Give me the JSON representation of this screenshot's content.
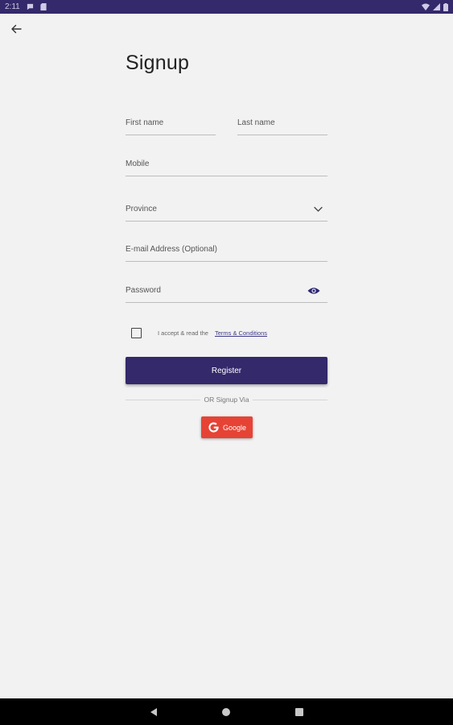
{
  "status_bar": {
    "time": "2:11",
    "left_icons": [
      "chat-icon",
      "sd-card-icon"
    ],
    "right_icons": [
      "wifi-icon",
      "signal-icon",
      "battery-icon"
    ],
    "background": "#33296b"
  },
  "header": {
    "back_icon": "arrow-left-icon",
    "title": "Signup"
  },
  "form": {
    "first_name_placeholder": "First name",
    "last_name_placeholder": "Last name",
    "mobile_placeholder": "Mobile",
    "province_placeholder": "Province",
    "email_placeholder": "E-mail Address (Optional)",
    "password_placeholder": "Password",
    "password_toggle_icon": "eye-icon"
  },
  "terms": {
    "checked": false,
    "text": "I accept & read the",
    "link": "Terms & Conditions"
  },
  "register": {
    "label": "Register",
    "color": "#33296b"
  },
  "divider": {
    "text": "OR Signup Via"
  },
  "social": {
    "google_label": "Google",
    "google_icon": "google-g-icon",
    "google_color": "#e64335"
  },
  "nav": {
    "back_icon": "triangle-back-icon",
    "home_icon": "circle-home-icon",
    "recents_icon": "square-recents-icon"
  }
}
